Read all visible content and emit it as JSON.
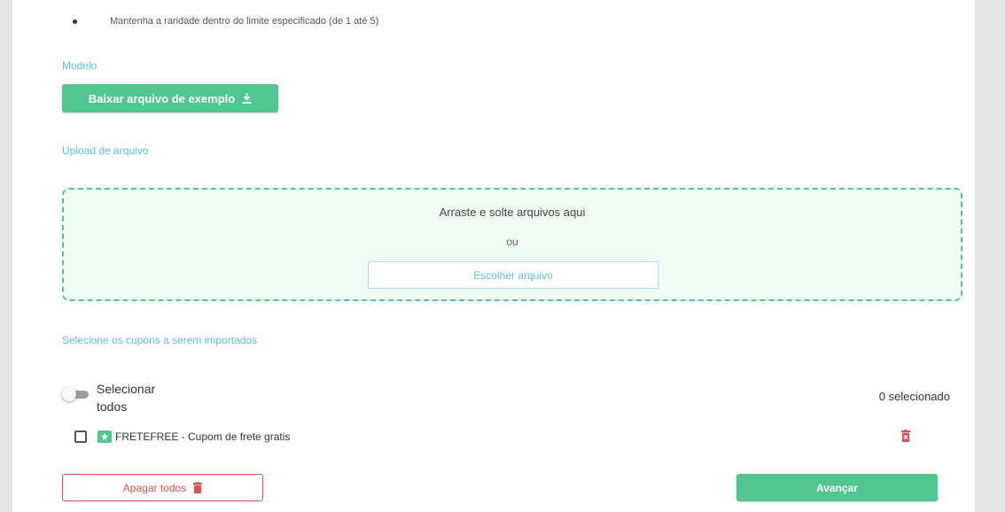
{
  "instructions": {
    "rarity_rule": "Mantenha a raridade dentro do limite especificado (de 1 até 5)"
  },
  "template_section": {
    "title": "Modelo",
    "download_button_label": "Baixar arquivo de exemplo",
    "download_icon": "download-icon"
  },
  "upload_section": {
    "title": "Upload de arquivo",
    "dropzone_text": "Arraste e solte arquivos aqui",
    "or_text": "ou",
    "choose_button_label": "Escolher arquivo"
  },
  "coupons_section": {
    "title": "Selecione os cupons a serem importados",
    "select_all_label": "Selecionar todos",
    "select_all_enabled": false,
    "selected_count_text": "0 selecionado",
    "items": [
      {
        "label": "FRETEFREE - Cupom de frete gratis",
        "checked": false,
        "icon": "star-ticket-icon"
      }
    ]
  },
  "footer": {
    "delete_all_label": "Apagar todos",
    "next_label": "Avançar"
  },
  "colors": {
    "accent_green": "#4fc78e",
    "accent_blue": "#5bc0de",
    "danger_red": "#e2504c",
    "dropzone_bg": "#eefaf4"
  }
}
